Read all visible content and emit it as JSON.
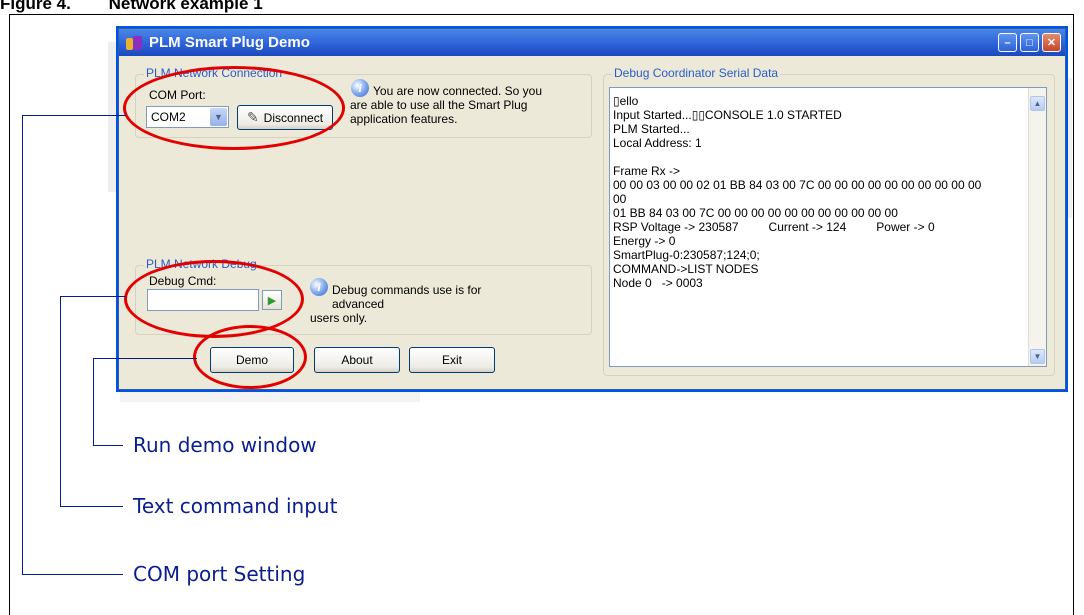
{
  "figure": {
    "caption": "Figure 4.        Network example 1"
  },
  "window": {
    "title": "PLM Smart Plug Demo",
    "controls": [
      "minimize",
      "maximize",
      "close"
    ]
  },
  "network_connection": {
    "group_title": "PLM Network Connection",
    "com_port_label": "COM Port:",
    "com_port_value": "COM2",
    "disconnect_label": "Disconnect",
    "info_lines": [
      "You are now connected. So you",
      "are able  to use all the  Smart Plug",
      "application features."
    ]
  },
  "network_debug": {
    "group_title": "PLM Network Debug",
    "debug_cmd_label": "Debug Cmd:",
    "debug_cmd_value": "",
    "info_lines": [
      "Debug commands use is for advanced",
      "users only."
    ]
  },
  "buttons": {
    "demo": "Demo",
    "about": "About",
    "exit": "Exit"
  },
  "serial_data": {
    "group_title": "Debug Coordinator Serial Data",
    "lines": [
      "▯ello",
      "Input Started...▯▯CONSOLE 1.0 STARTED",
      "PLM Started...",
      "Local Address: 1",
      "",
      "Frame Rx ->",
      "00 00 03 00 00 02 01 BB 84 03 00 7C 00 00 00 00 00 00 00 00 00 00",
      "00",
      "01 BB 84 03 00 7C 00 00 00 00 00 00 00 00 00 00 00",
      "RSP Voltage -> 230587         Current -> 124         Power -> 0",
      "Energy -> 0",
      "SmartPlug-0:230587;124;0;",
      "COMMAND->LIST NODES",
      "Node 0   -> 0003"
    ]
  },
  "callouts": {
    "run_demo": "Run demo window",
    "text_command": "Text command input",
    "com_port": "COM port Setting"
  },
  "colors": {
    "callout_ellipse": "#e30000",
    "leader_line": "#001e8c",
    "titlebar": "#2b5fd6",
    "window_body": "#ece9d8"
  }
}
